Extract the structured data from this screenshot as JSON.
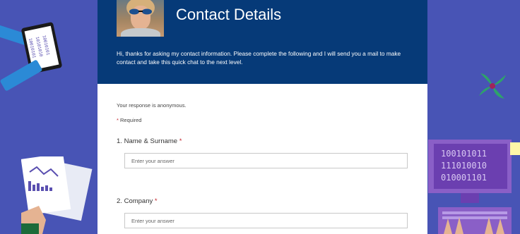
{
  "form": {
    "title": "Contact Details",
    "description": "Hi, thanks for asking my contact information. Please complete the following and I will send you a mail to make contact and take this quick chat to the next level.",
    "anonymous_note": "Your response is anonymous.",
    "required_marker": "*",
    "required_label": "Required",
    "questions": [
      {
        "number": "1.",
        "label": "Name & Surname",
        "required_marker": "*",
        "placeholder": "Enter your answer"
      },
      {
        "number": "2.",
        "label": "Company",
        "required_marker": "*",
        "placeholder": "Enter your answer"
      }
    ]
  },
  "decorations": {
    "tablet_text": "10010101 10101010 10010101",
    "monitor_text": [
      "100101011",
      "111010010",
      "010001101"
    ]
  },
  "colors": {
    "background": "#4854b5",
    "header": "#063a78",
    "required": "#c4262e"
  }
}
